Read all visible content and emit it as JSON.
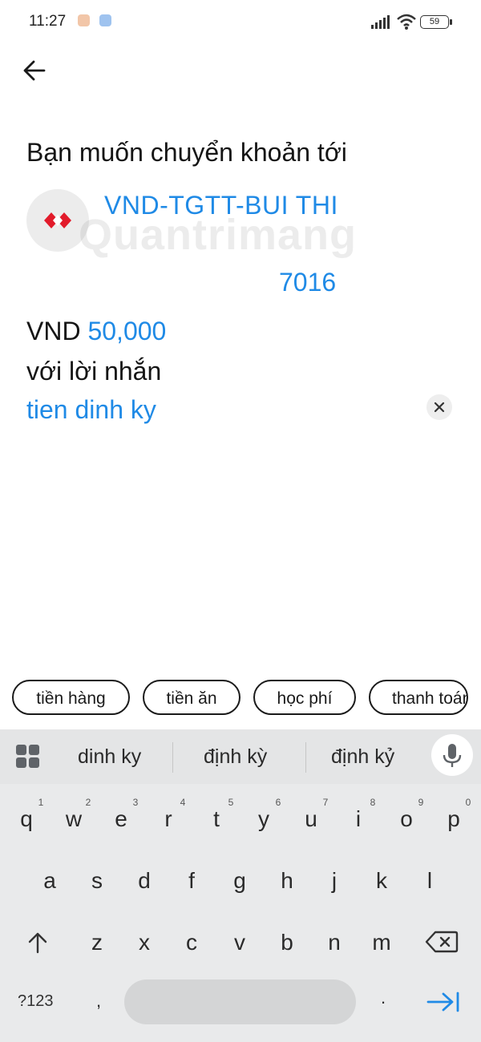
{
  "status_bar": {
    "time": "11:27",
    "battery": "59"
  },
  "header": {
    "title": "Bạn muốn chuyển khoản tới"
  },
  "recipient": {
    "name": "VND-TGTT-BUI THI",
    "account_suffix": "7016"
  },
  "amount": {
    "currency": "VND",
    "value": "50,000"
  },
  "message": {
    "label": "với lời nhắn",
    "value": "tien dinh ky"
  },
  "watermark": "Quantrimang",
  "quick_chips": [
    "tiền hàng",
    "tiền ăn",
    "học phí",
    "thanh toán"
  ],
  "keyboard": {
    "suggestions": [
      "dinh ky",
      "định kỳ",
      "định kỷ"
    ],
    "row1": [
      "q",
      "w",
      "e",
      "r",
      "t",
      "y",
      "u",
      "i",
      "o",
      "p"
    ],
    "row1_hints": [
      "1",
      "2",
      "3",
      "4",
      "5",
      "6",
      "7",
      "8",
      "9",
      "0"
    ],
    "row2": [
      "a",
      "s",
      "d",
      "f",
      "g",
      "h",
      "j",
      "k",
      "l"
    ],
    "row3": [
      "z",
      "x",
      "c",
      "v",
      "b",
      "n",
      "m"
    ],
    "symbols_key": "?123",
    "comma": ",",
    "period": "."
  },
  "colors": {
    "accent": "#1f8ae6",
    "keyboard_bg": "#e9eaeb",
    "brand_red": "#e21b2b"
  }
}
